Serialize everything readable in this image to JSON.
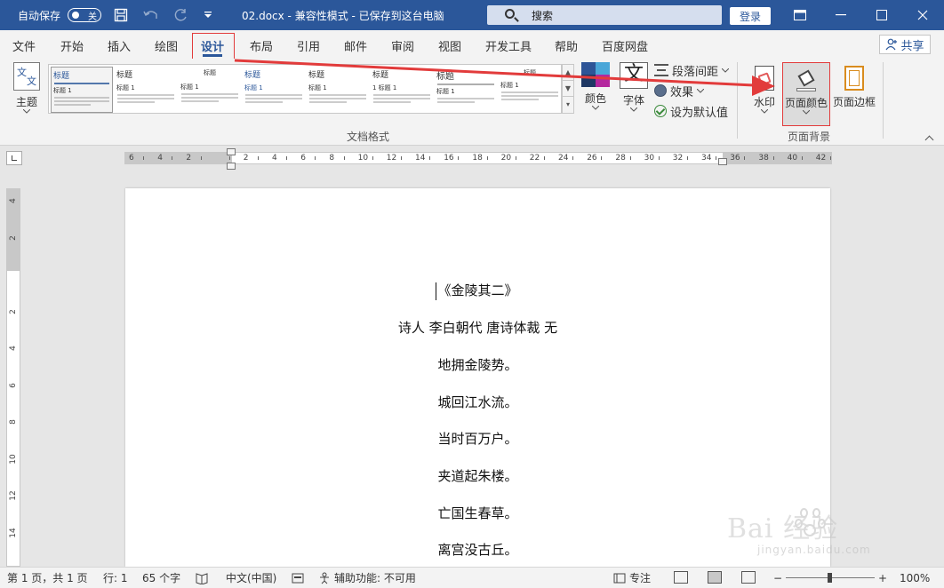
{
  "titlebar": {
    "autosave_label": "自动保存",
    "autosave_state": "关",
    "doc_title": "02.docx  -  兼容性模式  -  已保存到这台电脑",
    "dropdown_icon": "chevron-down-icon",
    "search_placeholder": "搜索",
    "login_label": "登录"
  },
  "tabs": [
    {
      "label": "文件",
      "active": false
    },
    {
      "label": "开始",
      "active": false
    },
    {
      "label": "插入",
      "active": false
    },
    {
      "label": "绘图",
      "active": false
    },
    {
      "label": "设计",
      "active": true
    },
    {
      "label": "布局",
      "active": false
    },
    {
      "label": "引用",
      "active": false
    },
    {
      "label": "邮件",
      "active": false
    },
    {
      "label": "审阅",
      "active": false
    },
    {
      "label": "视图",
      "active": false
    },
    {
      "label": "开发工具",
      "active": false
    },
    {
      "label": "帮助",
      "active": false
    },
    {
      "label": "百度网盘",
      "active": false
    }
  ],
  "share_label": "共享",
  "ribbon": {
    "theme": {
      "label": "主题",
      "icon_text_a": "文",
      "icon_text_b": "文"
    },
    "gallery_styles": [
      {
        "title": "标题",
        "heading": "标题 1"
      },
      {
        "title": "标题",
        "heading": "标题 1"
      },
      {
        "title": "标题",
        "heading": "标题 1"
      },
      {
        "title": "标题",
        "heading": "标题 1"
      },
      {
        "title": "标题",
        "heading": "标题 1"
      },
      {
        "title": "标题",
        "heading": "1  标题 1"
      },
      {
        "title": "标题",
        "heading": "标题 1"
      },
      {
        "title": "标题",
        "heading": "标题 1"
      }
    ],
    "colors_label": "颜色",
    "fonts_label": "字体",
    "font_icon_text": "文",
    "paragraph_spacing_label": "段落间距",
    "effects_label": "效果",
    "set_default_label": "设为默认值",
    "group_document_format": "文档格式",
    "watermark_label": "水印",
    "page_color_label": "页面颜色",
    "page_borders_label": "页面边框",
    "group_page_background": "页面背景",
    "colors_swatch": [
      "#2e5597",
      "#4aa6d8",
      "#1f3864",
      "#b4279e"
    ]
  },
  "ruler": {
    "labels": [
      "6",
      "4",
      "2",
      "",
      "2",
      "4",
      "6",
      "8",
      "10",
      "12",
      "14",
      "16",
      "18",
      "20",
      "22",
      "24",
      "26",
      "28",
      "30",
      "32",
      "34",
      "36",
      "38",
      "40",
      "42"
    ],
    "vertical_labels": [
      "4",
      "2",
      "",
      "2",
      "4",
      "6",
      "8",
      "10",
      "12",
      "14"
    ]
  },
  "document": {
    "lines": [
      "《金陵其二》",
      "诗人 李白朝代 唐诗体裁 无",
      "地拥金陵势。",
      "城回江水流。",
      "当时百万户。",
      "夹道起朱楼。",
      "亡国生春草。",
      "离宫没古丘。"
    ]
  },
  "watermark": {
    "main": "Bai  经验",
    "sub": "jingyan.baidu.com"
  },
  "status": {
    "page_info": "第 1 页，共 1 页",
    "line_info": "行: 1",
    "word_count": "65 个字",
    "language": "中文(中国)",
    "accessibility": "辅助功能: 不可用",
    "focus": "专注",
    "zoom_minus": "−",
    "zoom_plus": "+",
    "zoom": "100%"
  },
  "colors": {
    "title_bar": "#2b579a",
    "annotation": "#e23b3b",
    "ribbon_bg": "#f3f3f3"
  }
}
